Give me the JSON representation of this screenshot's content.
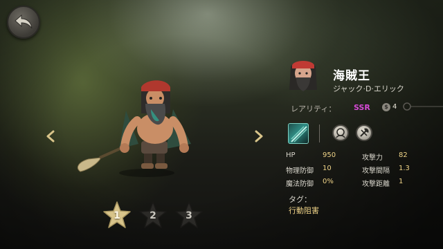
{
  "character": {
    "name": "海賊王",
    "subtitle": "ジャック·D·エリック",
    "rarity_label": "レアリティ：",
    "rarity_value": "SSR",
    "cost_icon_glyph": "$",
    "cost_value": "4"
  },
  "stats": {
    "left": [
      {
        "label": "HP",
        "value": "950"
      },
      {
        "label": "物理防御",
        "value": "10"
      },
      {
        "label": "魔法防御",
        "value": "0%"
      }
    ],
    "right": [
      {
        "label": "攻撃力",
        "value": "82"
      },
      {
        "label": "攻撃間隔",
        "value": "1.3"
      },
      {
        "label": "攻撃距離",
        "value": "1"
      }
    ]
  },
  "tags": {
    "label": "タグ：",
    "value": "行動阻害"
  },
  "stars": [
    {
      "label": "1",
      "active": true
    },
    {
      "label": "2",
      "active": false
    },
    {
      "label": "3",
      "active": false
    }
  ],
  "icons": {
    "back": "back-arrow-icon",
    "nav_left": "chevron-left-icon",
    "nav_right": "chevron-right-icon",
    "skill_main": "skill-icon",
    "skill_a": "face-icon",
    "skill_b": "axe-icon",
    "key": "key-icon"
  },
  "colors": {
    "rarity": "#d64ad6",
    "stat_value": "#f0d488",
    "star_active": "#d8c48a",
    "star_inactive": "#2b2a27"
  }
}
